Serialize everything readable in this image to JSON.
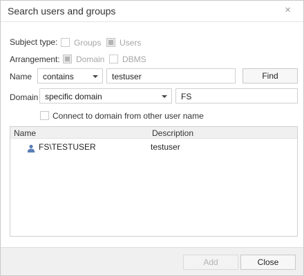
{
  "dialog": {
    "title": "Search users and groups",
    "close_glyph": "×"
  },
  "subject_type": {
    "label": "Subject type:",
    "groups_label": "Groups",
    "groups_checked": false,
    "users_label": "Users",
    "users_checked": true
  },
  "arrangement": {
    "label": "Arrangement:",
    "domain_label": "Domain",
    "domain_checked": true,
    "dbms_label": "DBMS",
    "dbms_checked": false
  },
  "name_row": {
    "label": "Name",
    "condition": "contains",
    "value": "testuser",
    "find_label": "Find"
  },
  "domain_row": {
    "label": "Domain",
    "selection": "specific domain",
    "value": "FS"
  },
  "connect_other": {
    "label": "Connect to domain from other user name",
    "checked": false
  },
  "results": {
    "columns": [
      "Name",
      "Description"
    ],
    "rows": [
      {
        "name": "FS\\TESTUSER",
        "description": "testuser",
        "icon": "user-icon"
      }
    ]
  },
  "footer": {
    "add_label": "Add",
    "close_label": "Close"
  },
  "colors": {
    "user_icon": "#5a7fb6",
    "disabled_text": "#a6a6a6",
    "footer_bg": "#f0f0f0"
  }
}
